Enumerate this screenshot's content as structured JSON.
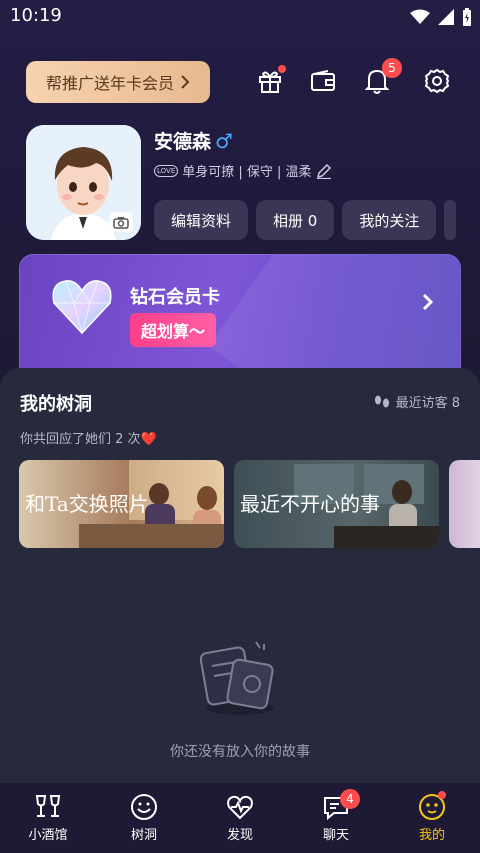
{
  "status_bar": {
    "time": "10:19"
  },
  "header": {
    "promo_label": "帮推广送年卡会员",
    "notification_count": "5"
  },
  "profile": {
    "name": "安德森",
    "gender_symbol": "♂",
    "love_tag": "LOVE",
    "tags": "单身可撩 | 保守 | 温柔",
    "buttons": {
      "edit": "编辑资料",
      "album": "相册 0",
      "follow": "我的关注"
    }
  },
  "vip": {
    "title": "钻石会员卡",
    "cta": "超划算～"
  },
  "tree_hole": {
    "title": "我的树洞",
    "visitors": "最近访客 8",
    "replied": "你共回应了她们 2 次❤️",
    "stories": [
      {
        "label": "和Ta交换照片"
      },
      {
        "label": "最近不开心的事"
      }
    ],
    "empty_text": "你还没有放入你的故事"
  },
  "nav": {
    "items": [
      {
        "label": "小酒馆"
      },
      {
        "label": "树洞"
      },
      {
        "label": "发现"
      },
      {
        "label": "聊天",
        "badge": "4"
      },
      {
        "label": "我的"
      }
    ]
  },
  "colors": {
    "accent": "#f5c518",
    "badge": "#ff4d4f",
    "vip_cta": "#ff3e8a"
  }
}
